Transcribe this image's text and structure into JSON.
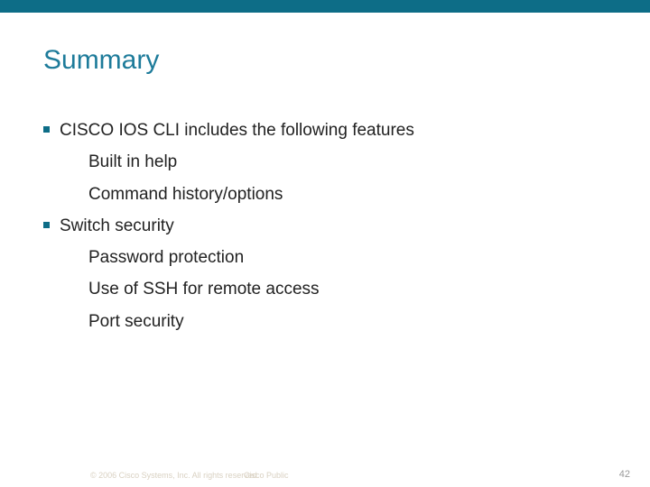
{
  "title": "Summary",
  "bullets": {
    "b1": "CISCO IOS CLI includes the following features",
    "b1a": "Built in help",
    "b1b": "Command history/options",
    "b2": "Switch security",
    "b2a": "Password protection",
    "b2b": "Use of SSH for remote access",
    "b2c": "Port security"
  },
  "footer": {
    "copyright": "© 2006 Cisco Systems, Inc. All rights reserved.",
    "label": "Cisco Public",
    "page": "42"
  }
}
